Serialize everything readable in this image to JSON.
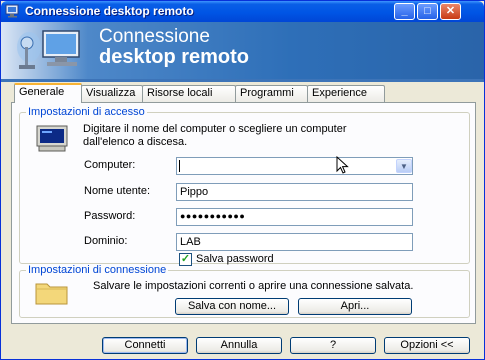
{
  "window": {
    "title": "Connessione desktop remoto"
  },
  "banner": {
    "line1": "Connessione",
    "line2": "desktop remoto"
  },
  "tabs": [
    {
      "label": "Generale",
      "active": true
    },
    {
      "label": "Visualizza"
    },
    {
      "label": "Risorse locali"
    },
    {
      "label": "Programmi"
    },
    {
      "label": "Experience"
    }
  ],
  "access": {
    "title": "Impostazioni di accesso",
    "description_line1": "Digitare il nome del computer o scegliere un computer",
    "description_line2": "dall'elenco a discesa.",
    "computer_label": "Computer:",
    "computer_value": "",
    "username_label": "Nome utente:",
    "username_value": "Pippo",
    "password_label": "Password:",
    "password_value": "●●●●●●●●●●●",
    "domain_label": "Dominio:",
    "domain_value": "LAB",
    "save_password_label": "Salva password",
    "save_password_checked": true
  },
  "connection": {
    "title": "Impostazioni di connessione",
    "description": "Salvare le impostazioni correnti o aprire una connessione salvata.",
    "save_as_label": "Salva con nome...",
    "open_label": "Apri..."
  },
  "footer": {
    "connect_label": "Connetti",
    "cancel_label": "Annulla",
    "help_label": "?",
    "options_label": "Opzioni <<"
  }
}
